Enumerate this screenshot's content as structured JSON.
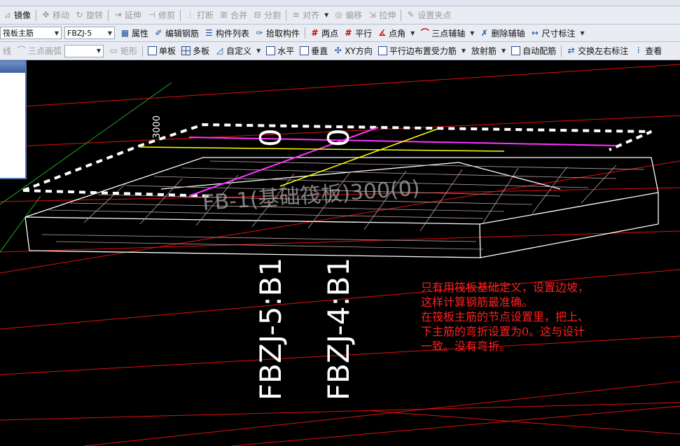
{
  "toolbar_top": {
    "items": [
      "镜像",
      "移动",
      "旋转",
      "延伸",
      "修剪",
      "打断",
      "合并",
      "分割",
      "对齐",
      "偏移",
      "拉伸",
      "设置夹点"
    ]
  },
  "toolbar_mid": {
    "combo1": "筏板主筋",
    "combo2": "FBZJ-5",
    "items": [
      "属性",
      "编辑钢筋",
      "构件列表",
      "拾取构件",
      "两点",
      "平行",
      "点角",
      "三点辅轴",
      "删除辅轴",
      "尺寸标注"
    ]
  },
  "toolbar_bot": {
    "items_disabled": [
      "三点画弧",
      "矩形"
    ],
    "left_fragment": "线",
    "combo_empty": "",
    "items": [
      "单板",
      "多板",
      "自定义",
      "水平",
      "垂直",
      "XY方向",
      "平行边布置受力筋",
      "放射筋",
      "自动配筋",
      "交换左右标注",
      "查看"
    ]
  },
  "canvas": {
    "dim_label": "3000",
    "rebar_label_1": "FBZJ-5:B1",
    "rebar_label_2": "FBZJ-4:B1",
    "rebar_suffix": "0",
    "plate_text": "FB-1(基础筏板)300(0)"
  },
  "annotation": {
    "lines": [
      "只有用筏板基础定义，设置边坡，",
      "这样计算钢筋最准确。",
      "在筏板主筋的节点设置里，把上、",
      "下主筋的弯折设置为0。这与设计",
      "一致。没有弯折。"
    ]
  },
  "colors": {
    "background": "#000000",
    "annotation": "#ff2020",
    "magenta_rebar": "#ff33ff",
    "yellow_rebar": "#ffff00",
    "grid_lines": "#e01010",
    "green_axis": "#1faa2a"
  }
}
